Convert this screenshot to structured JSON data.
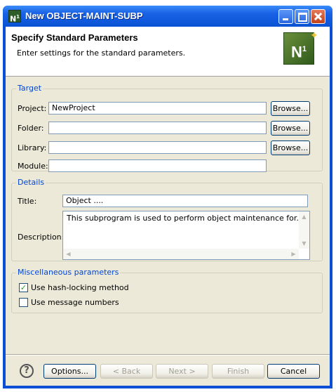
{
  "window": {
    "title": "New OBJECT-MAINT-SUBP",
    "icon": "N1"
  },
  "header": {
    "title": "Specify Standard Parameters",
    "description": "Enter settings for the standard parameters.",
    "logo": "N1"
  },
  "target": {
    "group_label": "Target",
    "project_label": "Project:",
    "project_value": "NewProject",
    "folder_label": "Folder:",
    "folder_value": "",
    "library_label": "Library:",
    "library_value": "",
    "module_label": "Module:",
    "module_value": "",
    "browse_label": "Browse..."
  },
  "details": {
    "group_label": "Details",
    "title_label": "Title:",
    "title_value": "Object ....",
    "description_label": "Description:",
    "description_value": "This subprogram is used to perform object maintenance for..."
  },
  "misc": {
    "group_label": "Miscellaneous parameters",
    "hash_locking_label": "Use hash-locking method",
    "hash_locking_checked": true,
    "message_numbers_label": "Use message numbers",
    "message_numbers_checked": false
  },
  "footer": {
    "options_label": "Options...",
    "back_label": "< Back",
    "next_label": "Next >",
    "finish_label": "Finish",
    "cancel_label": "Cancel"
  }
}
